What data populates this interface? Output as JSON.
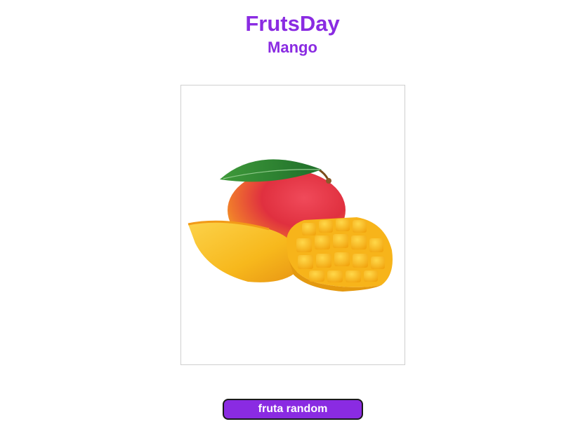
{
  "header": {
    "title": "FrutsDay",
    "fruit_name": "Mango"
  },
  "image": {
    "subject": "mango-fruit-image",
    "colors": {
      "accent": "#8a2be2",
      "leaf": "#2e7d32",
      "skin_red": "#e8364a",
      "flesh": "#f7b81c"
    }
  },
  "actions": {
    "random_label": "fruta random"
  }
}
